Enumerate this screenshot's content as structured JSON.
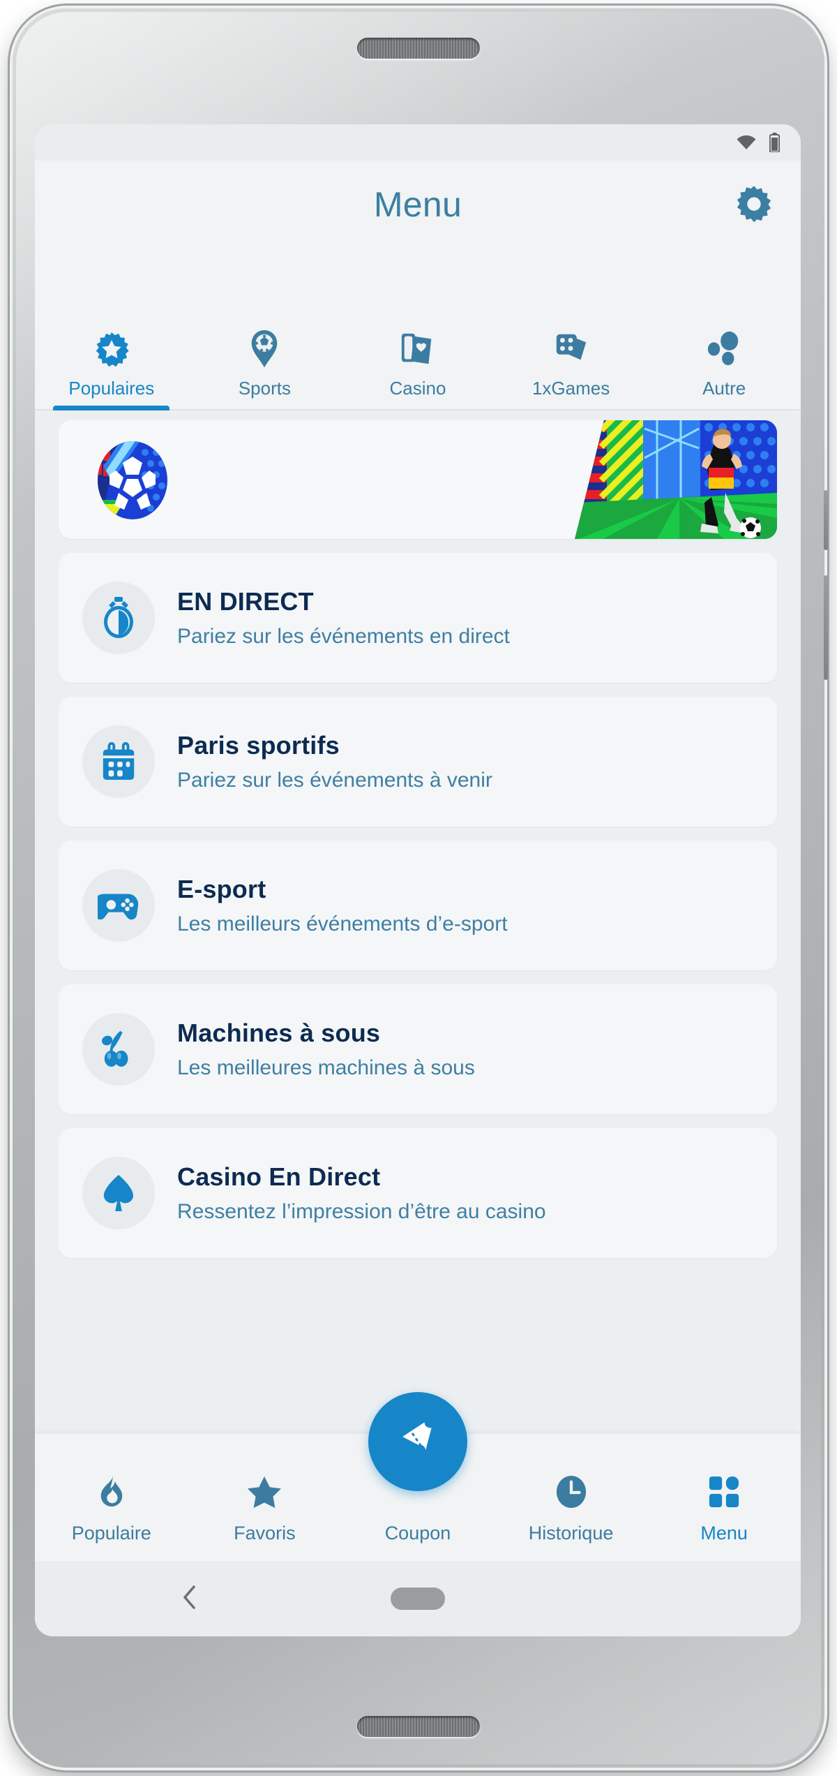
{
  "status_bar": {
    "wifi_icon": "wifi-icon",
    "battery_icon": "battery-icon"
  },
  "header": {
    "title": "Menu",
    "settings_icon": "gear-icon"
  },
  "category_tabs": [
    {
      "label": "Populaires",
      "icon": "star-burst-icon",
      "active": true
    },
    {
      "label": "Sports",
      "icon": "soccer-ball-pin-icon",
      "active": false
    },
    {
      "label": "Casino",
      "icon": "playing-cards-icon",
      "active": false
    },
    {
      "label": "1xGames",
      "icon": "dice-icon",
      "active": false
    },
    {
      "label": "Autre",
      "icon": "dots-group-icon",
      "active": false
    }
  ],
  "promo_banner": {
    "name": "football-promo-banner",
    "logo_icon": "colorful-soccer-ball-icon",
    "art_icon": "soccer-player-illustration"
  },
  "menu_items": [
    {
      "title": "EN DIRECT",
      "subtitle": "Pariez sur les événements en direct",
      "icon": "stopwatch-icon"
    },
    {
      "title": "Paris sportifs",
      "subtitle": "Pariez sur les événements à venir",
      "icon": "calendar-icon"
    },
    {
      "title": "E-sport",
      "subtitle": "Les meilleurs événements d’e-sport",
      "icon": "gamepad-icon"
    },
    {
      "title": "Machines à sous",
      "subtitle": "Les meilleures machines à sous",
      "icon": "cherries-icon"
    },
    {
      "title": "Casino En Direct",
      "subtitle": "Ressentez l’impression d’être au casino",
      "icon": "spade-icon"
    }
  ],
  "bottom_nav": [
    {
      "label": "Populaire",
      "icon": "flame-icon",
      "active": false
    },
    {
      "label": "Favoris",
      "icon": "star-icon",
      "active": false
    },
    {
      "label": "Coupon",
      "icon": "ticket-icon",
      "active": false
    },
    {
      "label": "Historique",
      "icon": "clock-icon",
      "active": false
    },
    {
      "label": "Menu",
      "icon": "grid-icon",
      "active": true
    }
  ],
  "android_nav": {
    "back_icon": "chevron-left-icon",
    "home_icon": "home-pill-icon"
  },
  "colors": {
    "accent": "#1686c8",
    "muted_blue": "#3c7ca0",
    "title_navy": "#0d2b52",
    "screen_bg": "#eceff1",
    "card_bg": "#f4f6f7"
  }
}
